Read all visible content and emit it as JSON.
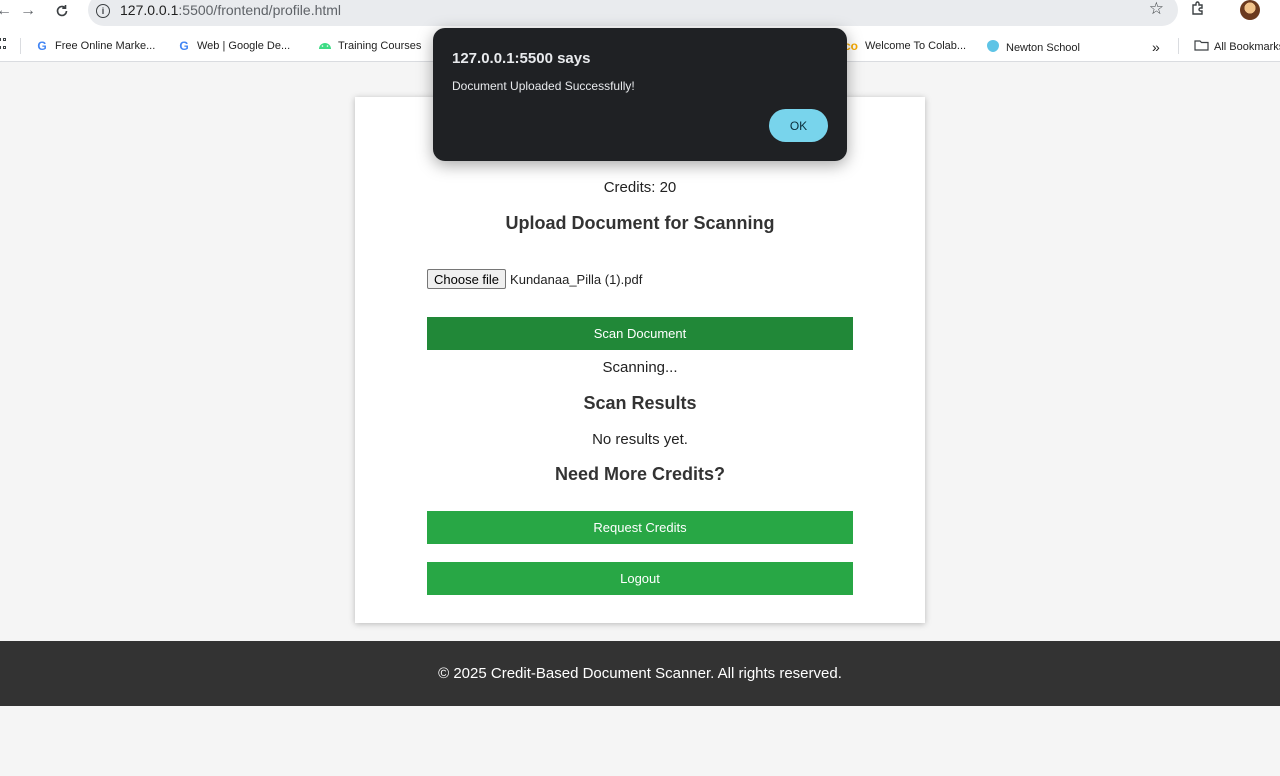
{
  "browser": {
    "url_host": "127.0.0.1",
    "url_path": ":5500/frontend/profile.html",
    "bookmarks": [
      {
        "label": "Free Online Marke...",
        "icon": "google-icon"
      },
      {
        "label": "Web  |  Google De...",
        "icon": "google-icon"
      },
      {
        "label": "Training Courses",
        "icon": "android-icon"
      },
      {
        "label": "Welcome To Colab...",
        "icon": "colab-icon"
      },
      {
        "label": "Newton School",
        "icon": "newton-icon"
      }
    ],
    "more_label": "»",
    "all_bookmarks_label": "All Bookmarks"
  },
  "page": {
    "credits_text": "Credits: 20",
    "upload_heading": "Upload Document for Scanning",
    "choose_file_label": "Choose file",
    "file_name": "Kundanaa_Pilla (1).pdf",
    "scan_button_label": "Scan Document",
    "scanning_text": "Scanning...",
    "results_heading": "Scan Results",
    "results_text": "No results yet.",
    "credits_heading": "Need More Credits?",
    "request_button_label": "Request Credits",
    "logout_button_label": "Logout"
  },
  "footer": {
    "text": "© 2025 Credit-Based Document Scanner. All rights reserved."
  },
  "dialog": {
    "title": "127.0.0.1:5500 says",
    "message": "Document Uploaded Successfully!",
    "ok_label": "OK"
  },
  "colors": {
    "scan_button": "#218838",
    "action_buttons": "#28a745",
    "footer_bg": "#333333",
    "dialog_bg": "#1f2124",
    "dialog_ok": "#78d4ec"
  }
}
